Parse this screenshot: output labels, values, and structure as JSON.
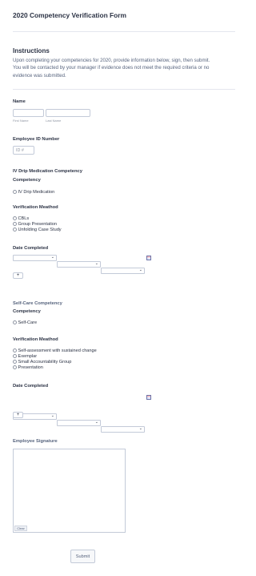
{
  "form_title": "2020 Competency Verification Form",
  "instructions": {
    "heading": "Instructions",
    "line1": "Upon completing your competencies for 2020, provide information below, sign, then submit.",
    "line2": "You will be contacted by your manager if evidence does not meet the required criteria or no",
    "line3": "evidence was submitted."
  },
  "name": {
    "label": "Name",
    "first_sublabel": "First Name",
    "last_sublabel": "Last Name",
    "first_value": "",
    "last_value": ""
  },
  "employee_id": {
    "label": "Employee ID Number",
    "placeholder": "ID #"
  },
  "iv_section": {
    "heading": "IV Drip Medication Competency",
    "competency_label": "Competency",
    "competency_option": "IV Drip Medication",
    "method_label": "Verification Meathod",
    "method_options": [
      "CBLs",
      "Group Presentation",
      "Unfolding Case Study"
    ],
    "date_label": "Date Completed",
    "add_button": "+"
  },
  "selfcare_section": {
    "heading": "Self-Care Competency",
    "competency_label": "Competency",
    "competency_option": "Self-Care",
    "method_label": "Verification Meathod",
    "method_options": [
      "Self-assessment with sustained change",
      "Exemplar",
      "Small Accountability Group",
      "Presentation"
    ],
    "date_label": "Date Completed",
    "add_button": "+"
  },
  "signature": {
    "label": "Employee Signature",
    "clear_button": "Clear"
  },
  "submit_button": "Submit",
  "icons": {
    "dropdown": "chevron-down-icon",
    "calendar": "calendar-icon",
    "radio": "radio-icon"
  }
}
